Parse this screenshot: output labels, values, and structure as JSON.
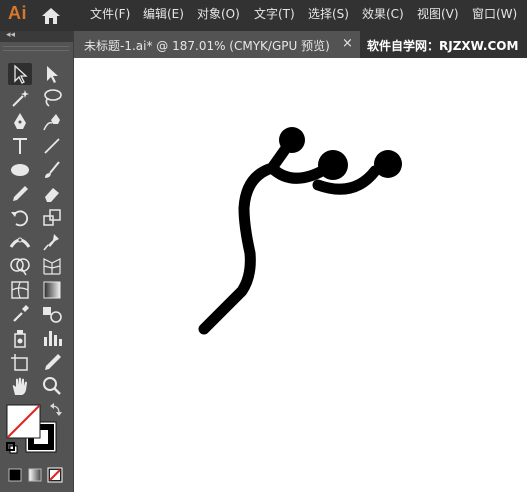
{
  "app": {
    "logo": "Ai"
  },
  "menu": {
    "items": [
      "文件(F)",
      "编辑(E)",
      "对象(O)",
      "文字(T)",
      "选择(S)",
      "效果(C)",
      "视图(V)",
      "窗口(W)"
    ]
  },
  "document": {
    "tab_title": "未标题-1.ai* @ 187.01% (CMYK/GPU 预览)",
    "close_glyph": "×"
  },
  "watermark": "软件自学网：RJZXW.COM",
  "toolbox": {
    "collapse_glyph": "◂◂",
    "tools": [
      "selection-tool",
      "direct-selection-tool",
      "magic-wand-tool",
      "lasso-tool",
      "pen-tool",
      "curvature-tool",
      "type-tool",
      "line-segment-tool",
      "ellipse-tool",
      "paintbrush-tool",
      "shaper-tool",
      "eraser-tool",
      "rotate-tool",
      "scale-tool",
      "width-tool",
      "puppet-warp-tool",
      "shape-builder-tool",
      "perspective-grid-tool",
      "mesh-tool",
      "gradient-tool",
      "eyedropper-tool",
      "blend-tool",
      "symbol-sprayer-tool",
      "column-graph-tool",
      "artboard-tool",
      "slice-tool",
      "hand-tool",
      "zoom-tool"
    ],
    "selected_tool": "selection-tool"
  },
  "colors": {
    "menubar_bg": "#323232",
    "panel_bg": "#535353",
    "accent_logo": "#d9772a",
    "fill_swatch": "none",
    "stroke_swatch": "#000000"
  }
}
